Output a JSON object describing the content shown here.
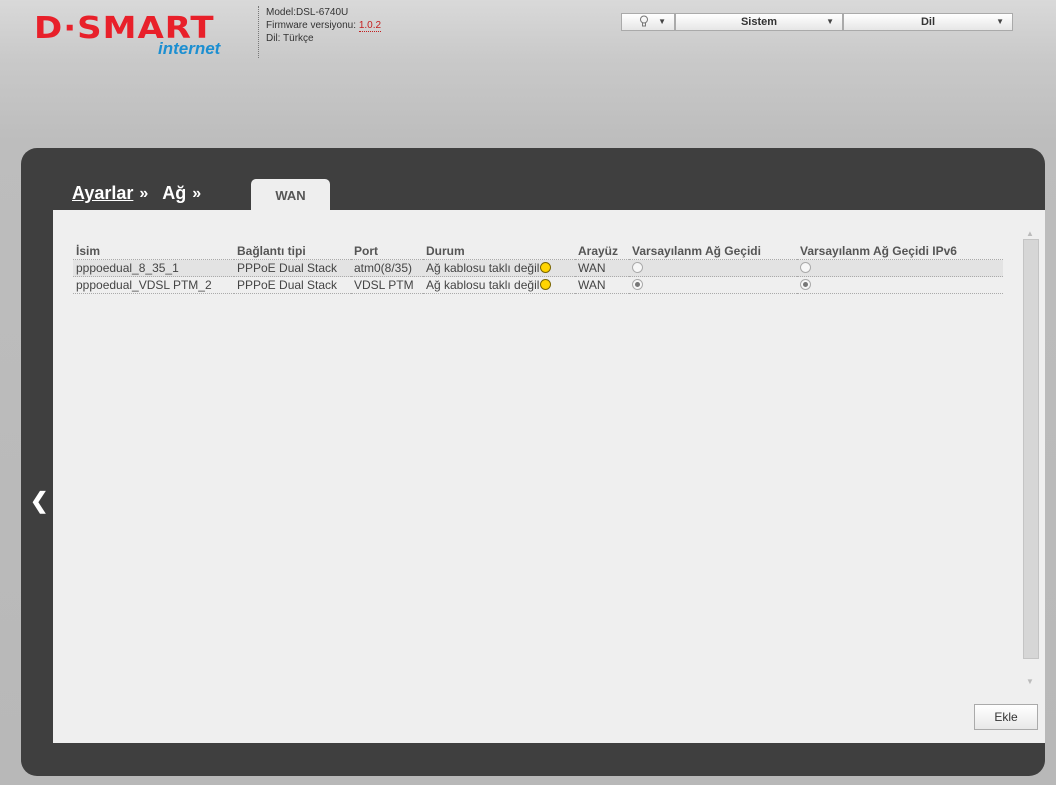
{
  "brand": {
    "logo_main": "D·SMART",
    "logo_sub": "internet"
  },
  "device": {
    "model": "Model:DSL-6740U",
    "firmware_label": "Firmware versiyonu: ",
    "firmware_value": "1.0.2",
    "language": "Dil: Türkçe"
  },
  "topbar": {
    "help_icon": "lightbulb-icon",
    "system_label": "Sistem",
    "language_label": "Dil"
  },
  "breadcrumb": {
    "item1": "Ayarlar",
    "sep1": "»",
    "item2": "Ağ",
    "sep2": "»"
  },
  "tab": {
    "label": "WAN"
  },
  "table": {
    "headers": [
      "İsim",
      "Bağlantı tipi",
      "Port",
      "Durum",
      "Arayüz",
      "Varsayılanm Ağ Geçidi",
      "Varsayılanm Ağ Geçidi IPv6"
    ],
    "rows": [
      {
        "name": "pppoedual_8_35_1",
        "type": "PPPoE Dual Stack",
        "port": "atm0(8/35)",
        "status": "Ağ kablosu taklı değil",
        "iface": "WAN",
        "gw": false,
        "gw6": false
      },
      {
        "name": "pppoedual_VDSL PTM_2",
        "type": "PPPoE Dual Stack",
        "port": "VDSL PTM",
        "status": "Ağ kablosu taklı değil",
        "iface": "WAN",
        "gw": true,
        "gw6": true
      }
    ]
  },
  "actions": {
    "add_label": "Ekle"
  },
  "colors": {
    "logo_red": "#e8202a",
    "logo_blue": "#1c8fd1",
    "status_dot": "#ffd400",
    "frame": "#3f3f3f"
  }
}
